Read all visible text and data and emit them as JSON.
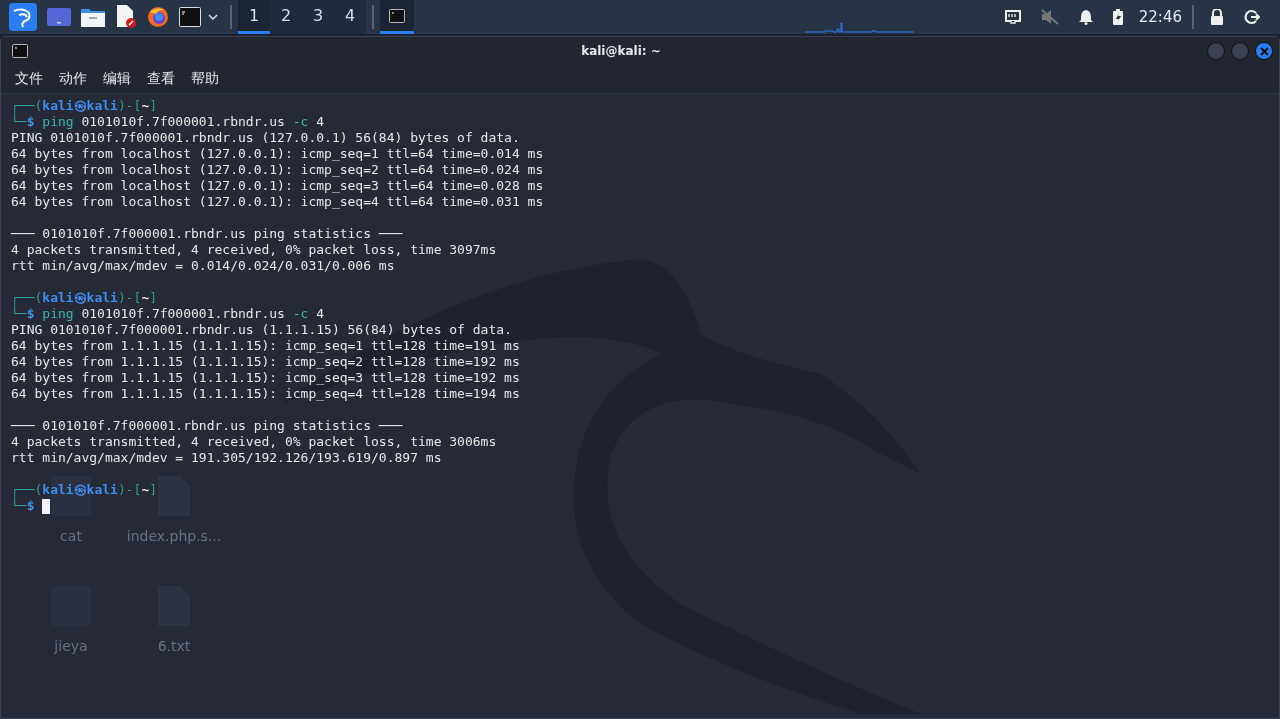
{
  "taskbar": {
    "workspaces": [
      {
        "label": "1",
        "selected": true
      },
      {
        "label": "2",
        "selected": false
      },
      {
        "label": "3",
        "selected": false
      },
      {
        "label": "4",
        "selected": false
      }
    ],
    "tasks": [
      {
        "selected": true
      }
    ],
    "time": "22:46"
  },
  "window": {
    "title": "kali@kali: ~",
    "menu": [
      "文件",
      "动作",
      "编辑",
      "查看",
      "帮助"
    ]
  },
  "desktop_icons": [
    {
      "label": "cat"
    },
    {
      "label": "index.php.s..."
    },
    {
      "label": "jieya"
    },
    {
      "label": "6.txt"
    }
  ],
  "terminal": {
    "lines": [
      {
        "kind": "prompt",
        "segments": [
          {
            "text": "┌──(",
            "kind": "frame"
          },
          {
            "text": "kali㉿kali",
            "kind": "user"
          },
          {
            "text": ")-[",
            "kind": "frame"
          },
          {
            "text": "~",
            "kind": "dir"
          },
          {
            "text": "]",
            "kind": "frame"
          }
        ]
      },
      {
        "kind": "command",
        "segments": [
          {
            "text": "└─",
            "kind": "frame"
          },
          {
            "text": "$ ",
            "kind": "user"
          },
          {
            "text": "ping",
            "kind": "cmd"
          },
          {
            "text": " 0101010f.7f000001.rbndr.us ",
            "kind": "plain"
          },
          {
            "text": "-c",
            "kind": "cmd"
          },
          {
            "text": " 4",
            "kind": "plain"
          }
        ]
      },
      {
        "kind": "output",
        "text": "PING 0101010f.7f000001.rbndr.us (127.0.0.1) 56(84) bytes of data."
      },
      {
        "kind": "output",
        "text": "64 bytes from localhost (127.0.0.1): icmp_seq=1 ttl=64 time=0.014 ms"
      },
      {
        "kind": "output",
        "text": "64 bytes from localhost (127.0.0.1): icmp_seq=2 ttl=64 time=0.024 ms"
      },
      {
        "kind": "output",
        "text": "64 bytes from localhost (127.0.0.1): icmp_seq=3 ttl=64 time=0.028 ms"
      },
      {
        "kind": "output",
        "text": "64 bytes from localhost (127.0.0.1): icmp_seq=4 ttl=64 time=0.031 ms"
      },
      {
        "kind": "blank"
      },
      {
        "kind": "output",
        "text": "─── 0101010f.7f000001.rbndr.us ping statistics ───"
      },
      {
        "kind": "output",
        "text": "4 packets transmitted, 4 received, 0% packet loss, time 3097ms"
      },
      {
        "kind": "output",
        "text": "rtt min/avg/max/mdev = 0.014/0.024/0.031/0.006 ms"
      },
      {
        "kind": "blank"
      },
      {
        "kind": "prompt",
        "segments": [
          {
            "text": "┌──(",
            "kind": "frame"
          },
          {
            "text": "kali㉿kali",
            "kind": "user"
          },
          {
            "text": ")-[",
            "kind": "frame"
          },
          {
            "text": "~",
            "kind": "dir"
          },
          {
            "text": "]",
            "kind": "frame"
          }
        ]
      },
      {
        "kind": "command",
        "segments": [
          {
            "text": "└─",
            "kind": "frame"
          },
          {
            "text": "$ ",
            "kind": "user"
          },
          {
            "text": "ping",
            "kind": "cmd"
          },
          {
            "text": " 0101010f.7f000001.rbndr.us ",
            "kind": "plain"
          },
          {
            "text": "-c",
            "kind": "cmd"
          },
          {
            "text": " 4",
            "kind": "plain"
          }
        ]
      },
      {
        "kind": "output",
        "text": "PING 0101010f.7f000001.rbndr.us (1.1.1.15) 56(84) bytes of data."
      },
      {
        "kind": "output",
        "text": "64 bytes from 1.1.1.15 (1.1.1.15): icmp_seq=1 ttl=128 time=191 ms"
      },
      {
        "kind": "output",
        "text": "64 bytes from 1.1.1.15 (1.1.1.15): icmp_seq=2 ttl=128 time=192 ms"
      },
      {
        "kind": "output",
        "text": "64 bytes from 1.1.1.15 (1.1.1.15): icmp_seq=3 ttl=128 time=192 ms"
      },
      {
        "kind": "output",
        "text": "64 bytes from 1.1.1.15 (1.1.1.15): icmp_seq=4 ttl=128 time=194 ms"
      },
      {
        "kind": "blank"
      },
      {
        "kind": "output",
        "text": "─── 0101010f.7f000001.rbndr.us ping statistics ───"
      },
      {
        "kind": "output",
        "text": "4 packets transmitted, 4 received, 0% packet loss, time 3006ms"
      },
      {
        "kind": "output",
        "text": "rtt min/avg/max/mdev = 191.305/192.126/193.619/0.897 ms"
      },
      {
        "kind": "blank"
      },
      {
        "kind": "prompt",
        "segments": [
          {
            "text": "┌──(",
            "kind": "frame"
          },
          {
            "text": "kali㉿kali",
            "kind": "user"
          },
          {
            "text": ")-[",
            "kind": "frame"
          },
          {
            "text": "~",
            "kind": "dir"
          },
          {
            "text": "]",
            "kind": "frame"
          }
        ]
      },
      {
        "kind": "command",
        "cursor": true,
        "segments": [
          {
            "text": "└─",
            "kind": "frame"
          },
          {
            "text": "$ ",
            "kind": "user"
          }
        ]
      }
    ]
  }
}
